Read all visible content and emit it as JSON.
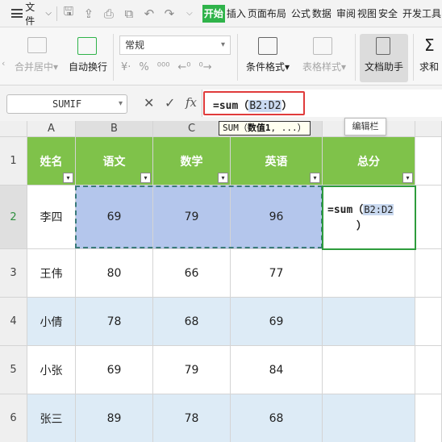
{
  "menubar": {
    "file_label": "文件",
    "tabs": [
      "开始",
      "插入",
      "页面布局",
      "公式",
      "数据",
      "审阅",
      "视图",
      "安全",
      "开发工具"
    ],
    "active_tab": "开始"
  },
  "ribbon": {
    "merge_label": "合并居中",
    "wrap_label": "自动换行",
    "number_format": "常规",
    "cond_format_label": "条件格式",
    "table_style_label": "表格样式",
    "doc_helper_label": "文档助手",
    "sum_label": "求和"
  },
  "formula_bar": {
    "name_box": "SUMIF",
    "fx_label": "fx",
    "formula_prefix": "=sum（",
    "formula_ref": "B2:D2",
    "formula_suffix": "）"
  },
  "tooltip": {
    "prefix": "SUM（",
    "bold_arg": "数值1",
    "suffix": ", ...）"
  },
  "edit_label": "编辑栏",
  "grid": {
    "columns": [
      "A",
      "B",
      "C",
      "D",
      "E"
    ],
    "rows": [
      "1",
      "2",
      "3",
      "4",
      "5",
      "6"
    ],
    "headers": [
      "姓名",
      "语文",
      "数学",
      "英语",
      "总分"
    ],
    "data": [
      [
        "李四",
        "69",
        "79",
        "96"
      ],
      [
        "王伟",
        "80",
        "66",
        "77"
      ],
      [
        "小倩",
        "78",
        "68",
        "69"
      ],
      [
        "小张",
        "69",
        "79",
        "84"
      ],
      [
        "张三",
        "89",
        "78",
        "68"
      ]
    ],
    "active_formula_line1_prefix": "=sum（",
    "active_formula_ref": "B2:D2",
    "active_formula_line2": "）"
  },
  "colors": {
    "header_green": "#7fc24a",
    "band_blue": "#ddebf6",
    "selection_blue": "#b4c6ec",
    "active_tab_green": "#2fb34a",
    "highlight_red": "#e03b3b"
  }
}
